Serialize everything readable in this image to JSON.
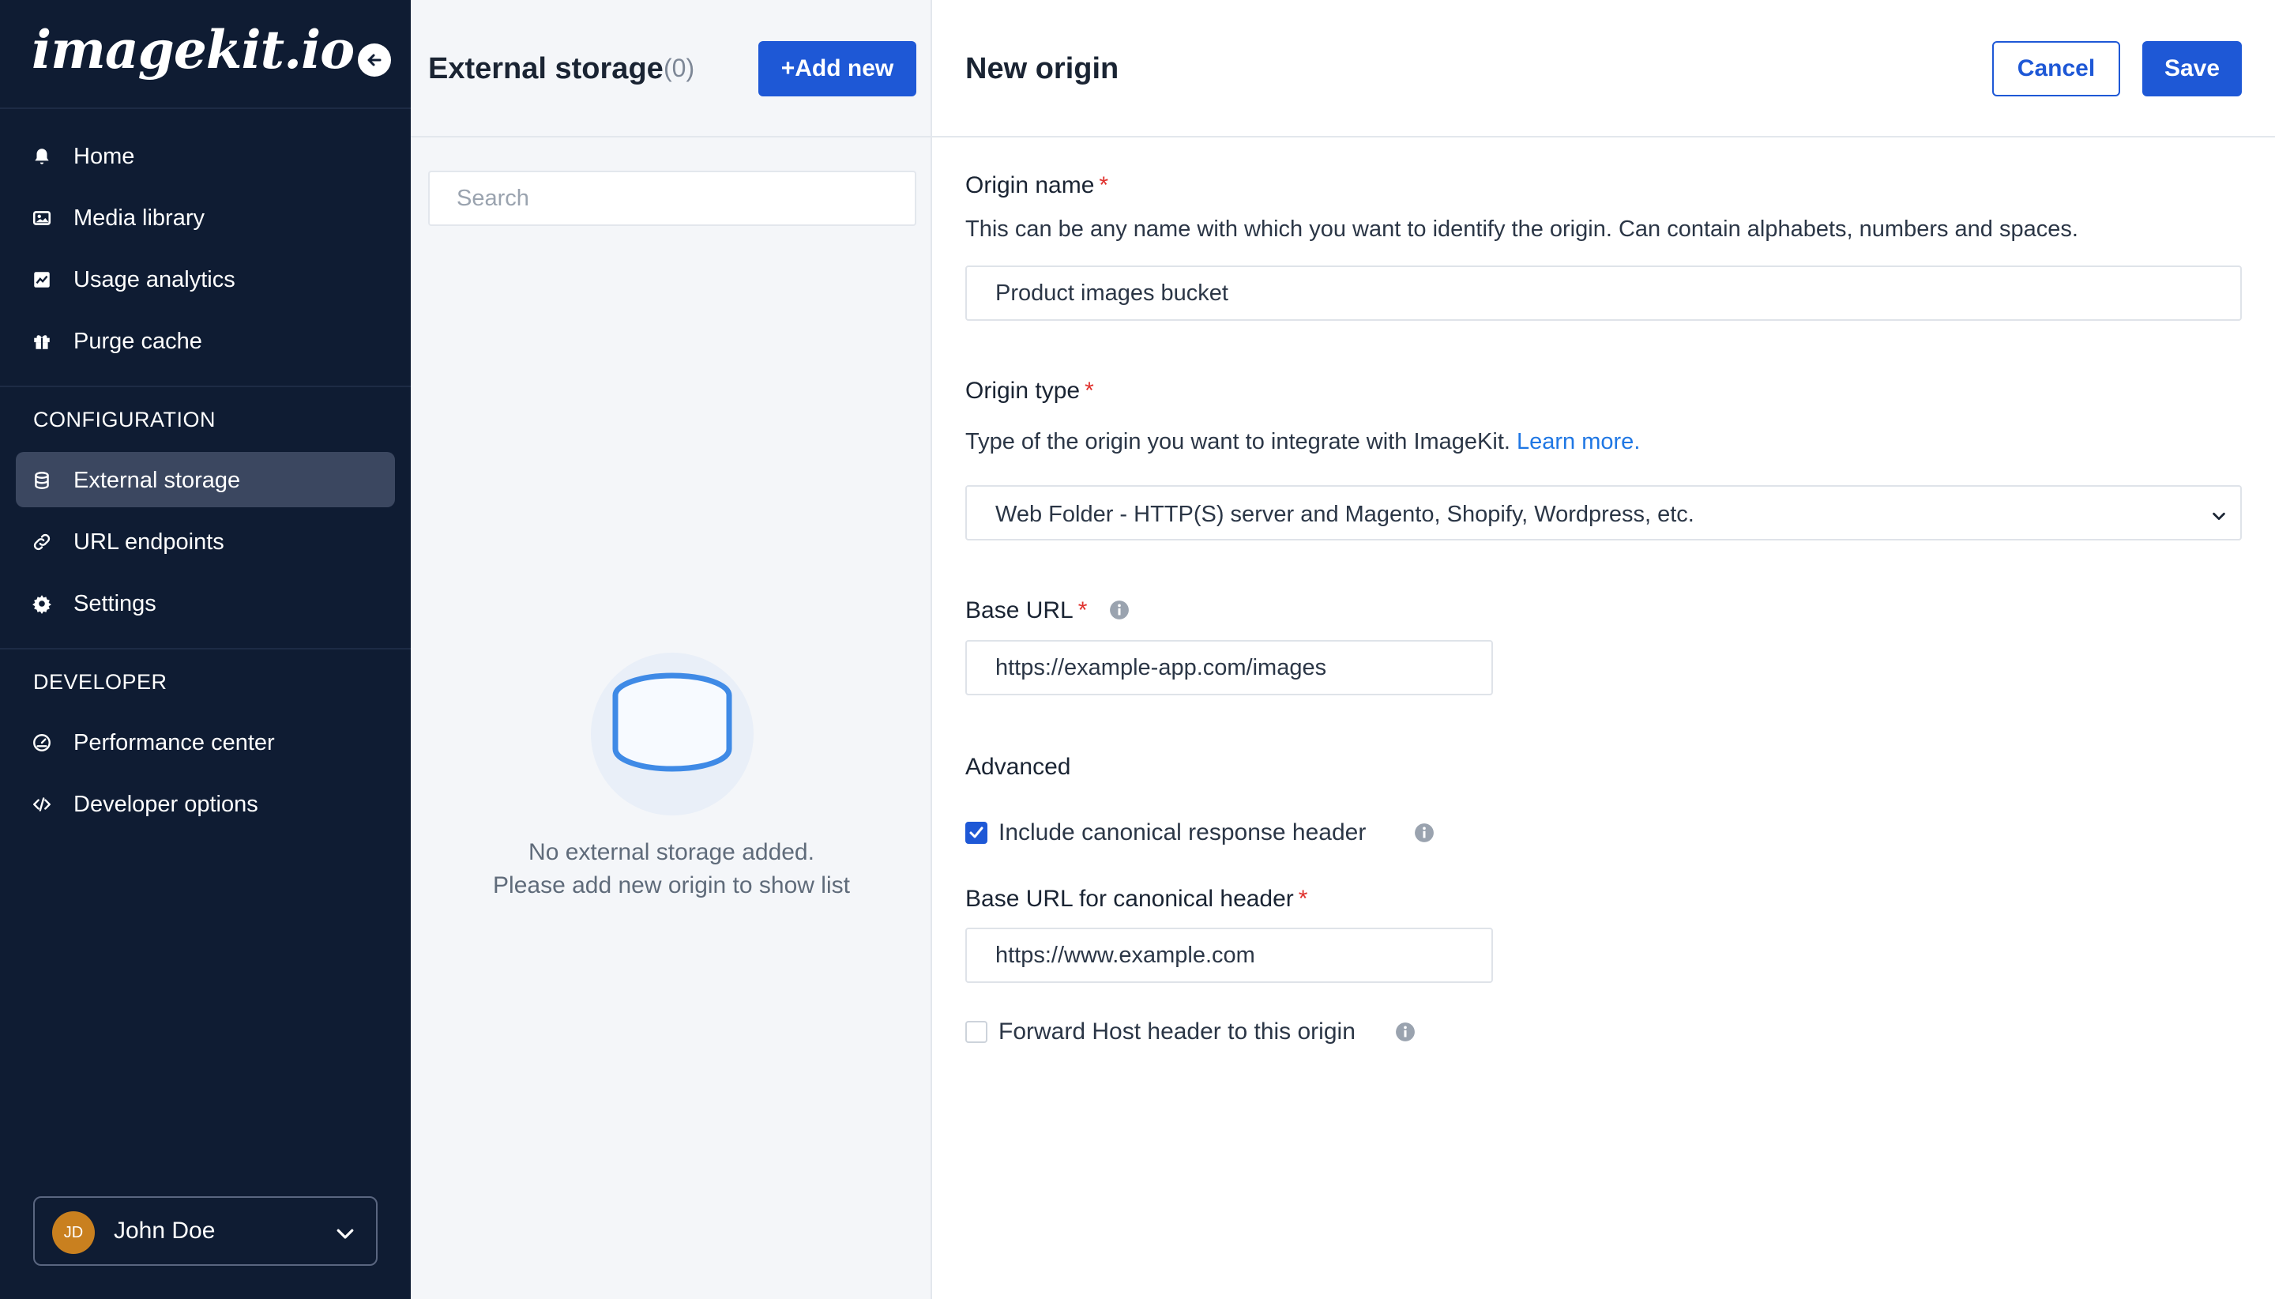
{
  "sidebar": {
    "logo": "imagekit.io",
    "collapse_icon": "arrow-left-circle-icon",
    "main_items": [
      {
        "label": "Home",
        "icon": "bell-icon"
      },
      {
        "label": "Media library",
        "icon": "media-icon"
      },
      {
        "label": "Usage analytics",
        "icon": "chart-icon"
      },
      {
        "label": "Purge cache",
        "icon": "gift-icon"
      }
    ],
    "configuration": {
      "title": "CONFIGURATION",
      "items": [
        {
          "label": "External storage",
          "icon": "database-icon",
          "active": true
        },
        {
          "label": "URL endpoints",
          "icon": "link-icon"
        },
        {
          "label": "Settings",
          "icon": "gear-icon"
        }
      ]
    },
    "developer": {
      "title": "DEVELOPER",
      "items": [
        {
          "label": "Performance center",
          "icon": "gauge-icon"
        },
        {
          "label": "Developer options",
          "icon": "code-icon"
        }
      ]
    },
    "user": {
      "initials": "JD",
      "name": "John Doe"
    }
  },
  "middle": {
    "title": "External storage",
    "count": "(0)",
    "add_button": "+Add new",
    "search_placeholder": "Search",
    "empty_line1": "No external storage added.",
    "empty_line2": "Please add new origin to show list"
  },
  "panel": {
    "title": "New origin",
    "cancel": "Cancel",
    "save": "Save",
    "origin_name": {
      "label": "Origin name",
      "required_mark": "*",
      "help": "This can be any name with which you want to identify the origin. Can contain alphabets, numbers and spaces.",
      "value": "Product images bucket"
    },
    "origin_type": {
      "label": "Origin type",
      "required_mark": "*",
      "help": "Type of the origin you want to integrate with ImageKit.",
      "help_link": "Learn more.",
      "value": "Web Folder - HTTP(S) server and Magento, Shopify, Wordpress, etc."
    },
    "base_url": {
      "label": "Base URL",
      "required_mark": "*",
      "value": "https://example-app.com/images"
    },
    "advanced": {
      "title": "Advanced",
      "canonical_checkbox": {
        "label": "Include canonical response header",
        "checked": true
      },
      "canonical_base_url": {
        "label": "Base URL for canonical header",
        "required_mark": "*",
        "value": "https://www.example.com"
      },
      "forward_host_checkbox": {
        "label": "Forward Host header to this origin",
        "checked": false
      }
    }
  },
  "colors": {
    "sidebar_bg": "#0f1c33",
    "accent": "#1e58d6",
    "link": "#1f77e4",
    "required": "#e0322e"
  }
}
